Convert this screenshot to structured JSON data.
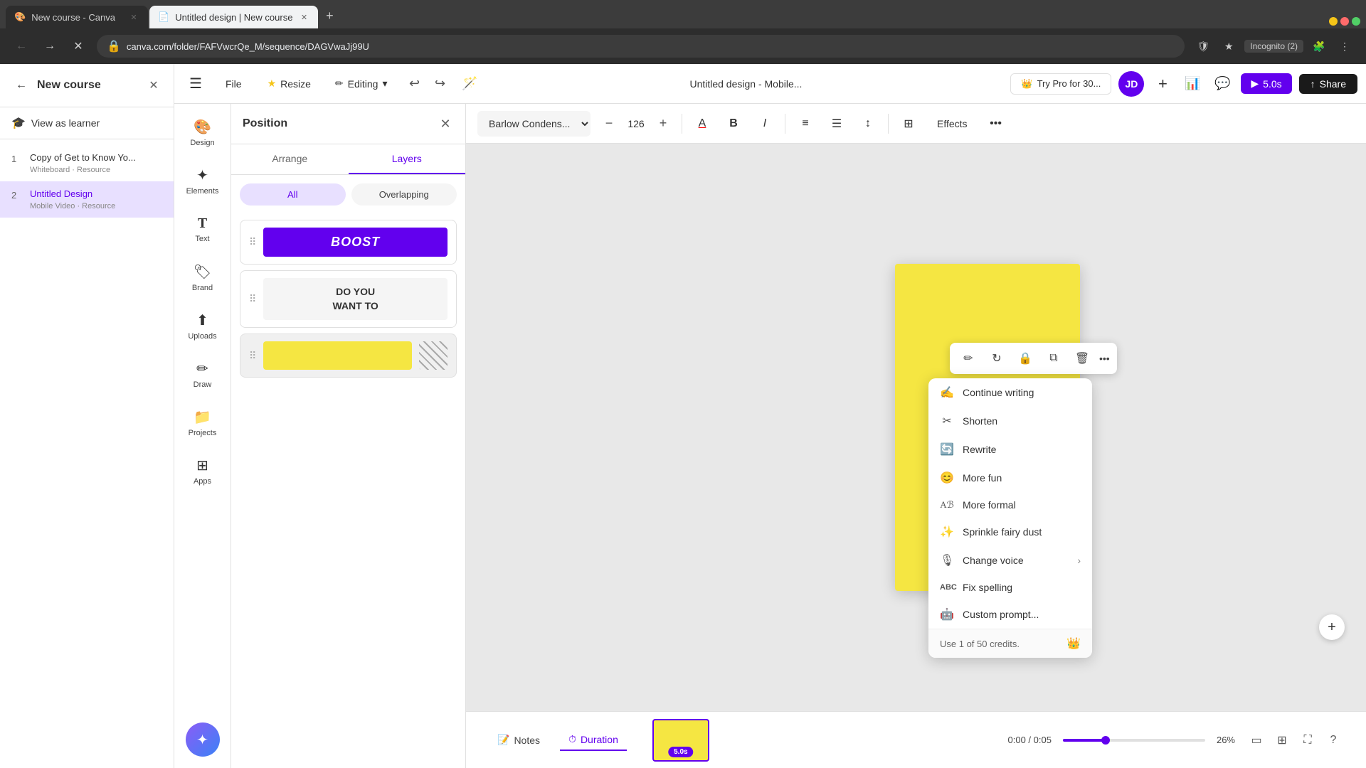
{
  "browser": {
    "tabs": [
      {
        "label": "New course - Canva",
        "active": false,
        "favicon": "🎨"
      },
      {
        "label": "Untitled design | New course",
        "active": true,
        "favicon": "📄"
      }
    ],
    "url": "canva.com/folder/FAFVwcrQe_M/sequence/DAGVwaJj99U",
    "incognito_label": "Incognito (2)"
  },
  "course_sidebar": {
    "title": "New course",
    "view_as_learner_label": "View as learner",
    "items": [
      {
        "number": "1",
        "title": "Copy of Get to Know Yo...",
        "subtitle": "Whiteboard · Resource"
      },
      {
        "number": "2",
        "title": "Untitled Design",
        "subtitle": "Mobile Video · Resource",
        "active": true
      }
    ]
  },
  "tool_sidebar": {
    "items": [
      {
        "icon": "🎨",
        "label": "Design"
      },
      {
        "icon": "✦",
        "label": "Elements"
      },
      {
        "icon": "T",
        "label": "Text"
      },
      {
        "icon": "🏷",
        "label": "Brand"
      },
      {
        "icon": "⬆",
        "label": "Uploads"
      },
      {
        "icon": "✏",
        "label": "Draw"
      },
      {
        "icon": "📁",
        "label": "Projects"
      },
      {
        "icon": "⊞",
        "label": "Apps"
      }
    ]
  },
  "position_panel": {
    "title": "Position",
    "tabs": [
      "Arrange",
      "Layers"
    ],
    "active_tab": "Layers",
    "filter_all": "All",
    "filter_overlapping": "Overlapping",
    "active_filter": "All",
    "layers": [
      {
        "type": "boost",
        "text": "BOOST"
      },
      {
        "type": "text",
        "text": "DO YOU\nWANT TO"
      },
      {
        "type": "yellow",
        "text": ""
      }
    ]
  },
  "canva_header": {
    "file_label": "File",
    "resize_label": "Resize",
    "editing_label": "Editing",
    "doc_title": "Untitled design - Mobile...",
    "try_pro_label": "Try Pro for 30...",
    "avatar_initials": "JD",
    "play_label": "5.0s",
    "share_label": "Share"
  },
  "canvas_toolbar": {
    "font_name": "Barlow Condens...",
    "font_size": "126",
    "effects_label": "Effects"
  },
  "context_menu": {
    "items": [
      {
        "icon": "✍",
        "label": "Continue writing",
        "has_arrow": false
      },
      {
        "icon": "✂",
        "label": "Shorten",
        "has_arrow": false
      },
      {
        "icon": "🔄",
        "label": "Rewrite",
        "has_arrow": false
      },
      {
        "icon": "😊",
        "label": "More fun",
        "has_arrow": false
      },
      {
        "icon": "Aℬ",
        "label": "More formal",
        "has_arrow": false
      },
      {
        "icon": "✨",
        "label": "Sprinkle fairy dust",
        "has_arrow": false
      },
      {
        "icon": "🎙",
        "label": "Change voice",
        "has_arrow": true
      },
      {
        "icon": "ABC",
        "label": "Fix spelling",
        "has_arrow": false
      },
      {
        "icon": "🤖",
        "label": "Custom prompt...",
        "has_arrow": false
      }
    ],
    "footer": "Use 1 of 50 credits."
  },
  "timeline": {
    "notes_label": "Notes",
    "duration_label": "Duration",
    "time": "0:00 / 0:05",
    "zoom": "26%"
  },
  "slide": {
    "duration_badge": "5.0s"
  }
}
